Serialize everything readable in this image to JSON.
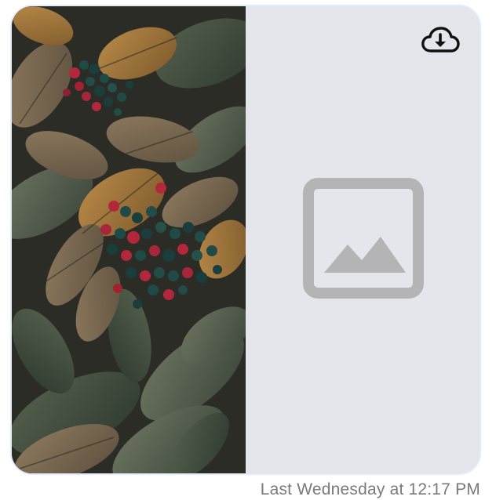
{
  "message": {
    "timestamp": "Last Wednesday at 12:17 PM"
  },
  "attachments": [
    {
      "kind": "photo",
      "subject": "berries-and-leaves-photo"
    },
    {
      "kind": "image-placeholder",
      "icon": "image-placeholder-icon",
      "action_icon": "cloud-download-icon"
    }
  ],
  "colors": {
    "card_background": "#e5e6eb",
    "card_border": "#e3ecfa",
    "placeholder_icon": "#b4b4b6",
    "timestamp_text": "#7a7a7e",
    "download_icon": "#111111"
  }
}
